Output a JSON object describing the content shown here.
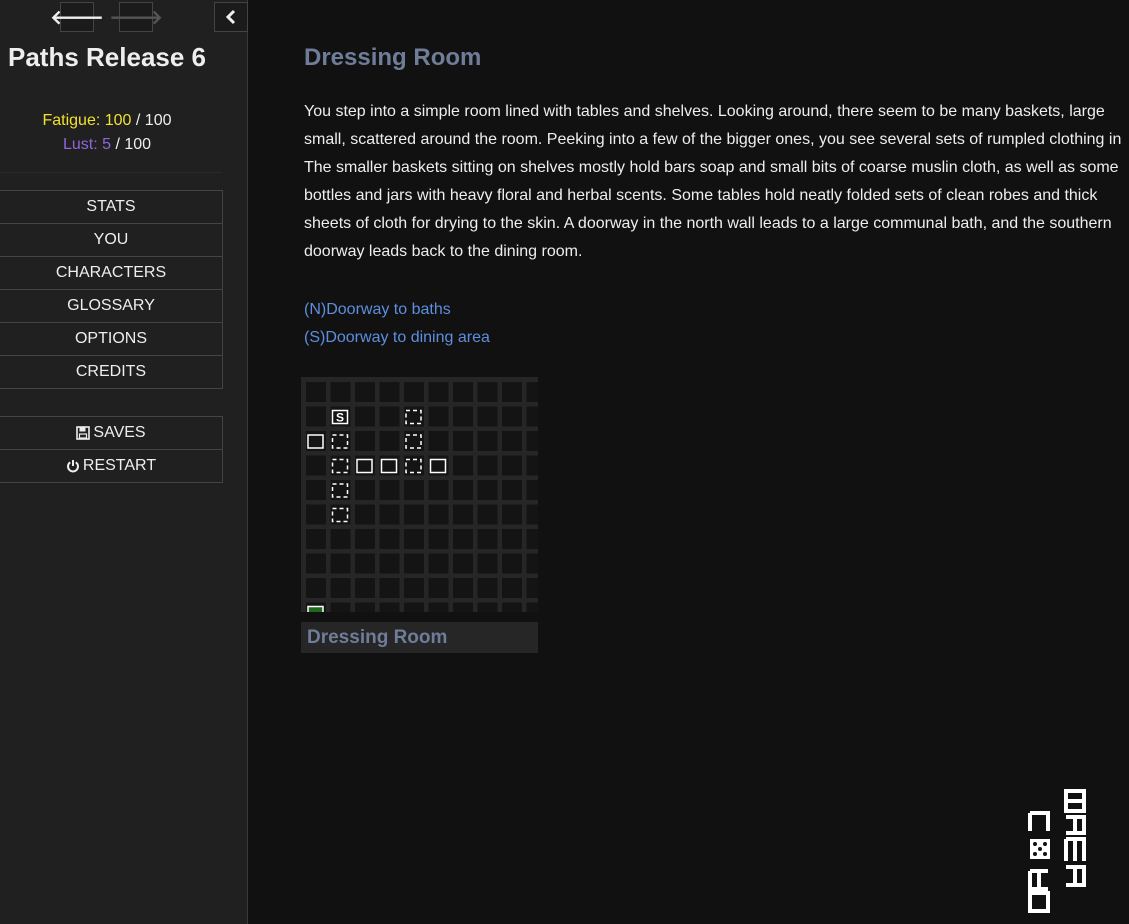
{
  "sidebar": {
    "title": "Paths Release 6",
    "nav": {
      "back_icon": "arrow-left-icon",
      "forward_icon": "arrow-right-icon",
      "collapse_icon": "chevron-left-icon"
    },
    "stats": {
      "fatigue_label": "Fatigue:",
      "fatigue_value": "100",
      "fatigue_max": "/ 100",
      "lust_label": "Lust:",
      "lust_value": "5",
      "lust_max": "/ 100"
    },
    "menu": [
      "STATS",
      "YOU",
      "CHARACTERS",
      "GLOSSARY",
      "OPTIONS",
      "CREDITS"
    ],
    "saves_label": "SAVES",
    "restart_label": "RESTART"
  },
  "passage": {
    "title": "Dressing Room",
    "description": "You step into a simple room lined with tables and shelves. Looking around, there seem to be many baskets, large\nsmall, scattered around the room. Peeking into a few of the bigger ones, you see several sets of rumpled clothing in\nThe smaller baskets sitting on shelves mostly hold bars soap and small bits of coarse muslin cloth, as well as some\nbottles and jars with heavy floral and herbal scents. Some tables hold neatly folded sets of clean robes and thick\nsheets of cloth for drying to the skin. A doorway in the north wall leads to a large communal bath, and the southern\ndoorway leads back to the dining room.",
    "exits": [
      "(N)Doorway to baths",
      "(S)Doorway to dining area"
    ]
  },
  "map": {
    "label": "Dressing Room",
    "stairs_glyph": "S",
    "colors": {
      "background": "#262626",
      "cell": "#141414",
      "player": "#1e6b1e"
    }
  },
  "logo": {
    "text": "gamecore",
    "icon": "dice-icon"
  }
}
